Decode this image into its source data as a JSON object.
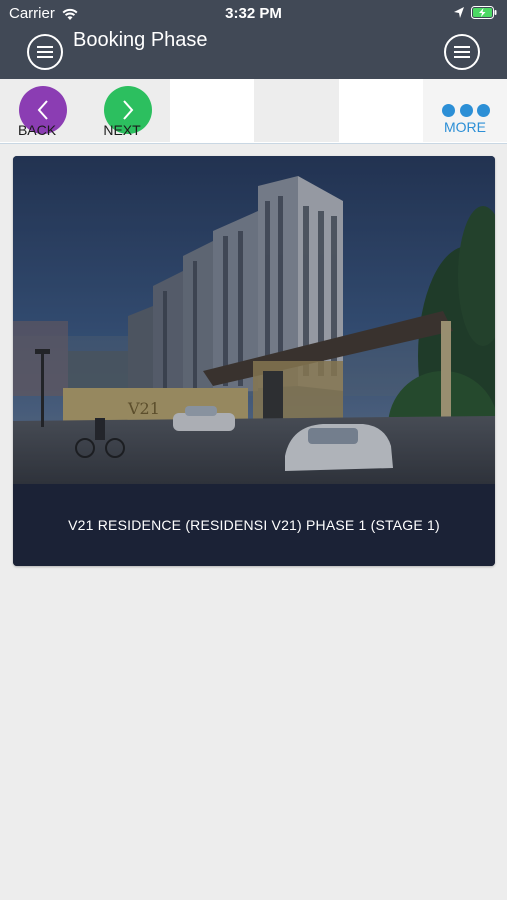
{
  "status_bar": {
    "carrier": "Carrier",
    "time": "3:32 PM",
    "icons": [
      "wifi-icon",
      "location-arrow-icon",
      "battery-charging-icon"
    ]
  },
  "header": {
    "title": "Booking Phase",
    "left_icon": "menu-icon",
    "right_icon": "menu-icon",
    "background_color": "#414956"
  },
  "toolbar": {
    "back_label": "BACK",
    "next_label": "NEXT",
    "more_label": "MORE",
    "back_color": "#8b3db3",
    "next_color": "#2cbf5f",
    "more_color": "#2c8fd6"
  },
  "card": {
    "caption": "V21 RESIDENCE (RESIDENSI V21) PHASE 1 (STAGE 1)",
    "image_subject": "apartment-building-render",
    "caption_background": "#1b2236"
  }
}
